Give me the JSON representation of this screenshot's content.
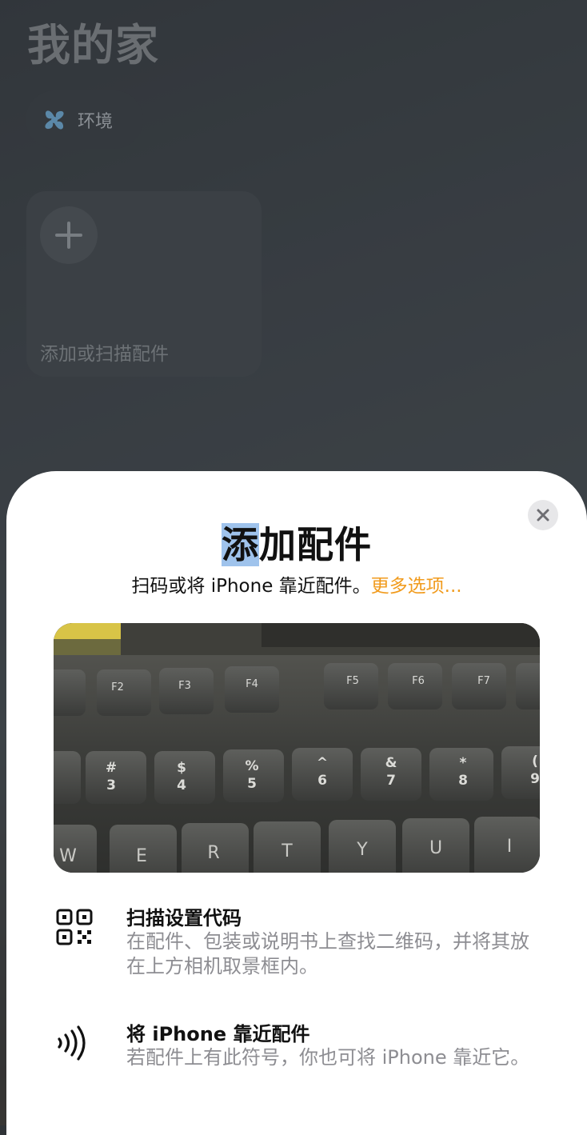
{
  "home": {
    "title": "我的家",
    "environment_chip": {
      "label": "环境",
      "icon": "fan-icon"
    },
    "add_tile": {
      "label": "添加或扫描配件",
      "icon": "plus-icon"
    }
  },
  "sheet": {
    "title_first_char": "添",
    "title_rest": "加配件",
    "subtitle": "扫码或将 iPhone 靠近配件。",
    "more_link": "更多选项...",
    "close_icon": "close-icon",
    "accent_color": "#f19b1d",
    "camera": {
      "visible_texts": [
        "F2",
        "F3",
        "F4",
        "F5",
        "F6",
        "F7",
        "#",
        "3",
        "$",
        "4",
        "%",
        "5",
        "^",
        "6",
        "&",
        "7",
        "*",
        "8",
        "(",
        "9",
        "W",
        "E",
        "R",
        "T",
        "Y",
        "U",
        "I"
      ]
    },
    "options": [
      {
        "icon": "qr-code-icon",
        "title": "扫描设置代码",
        "description": "在配件、包装或说明书上查找二维码，并将其放在上方相机取景框内。"
      },
      {
        "icon": "nfc-icon",
        "title": "将 iPhone 靠近配件",
        "description": "若配件上有此符号，你也可将 iPhone 靠近它。"
      }
    ]
  }
}
